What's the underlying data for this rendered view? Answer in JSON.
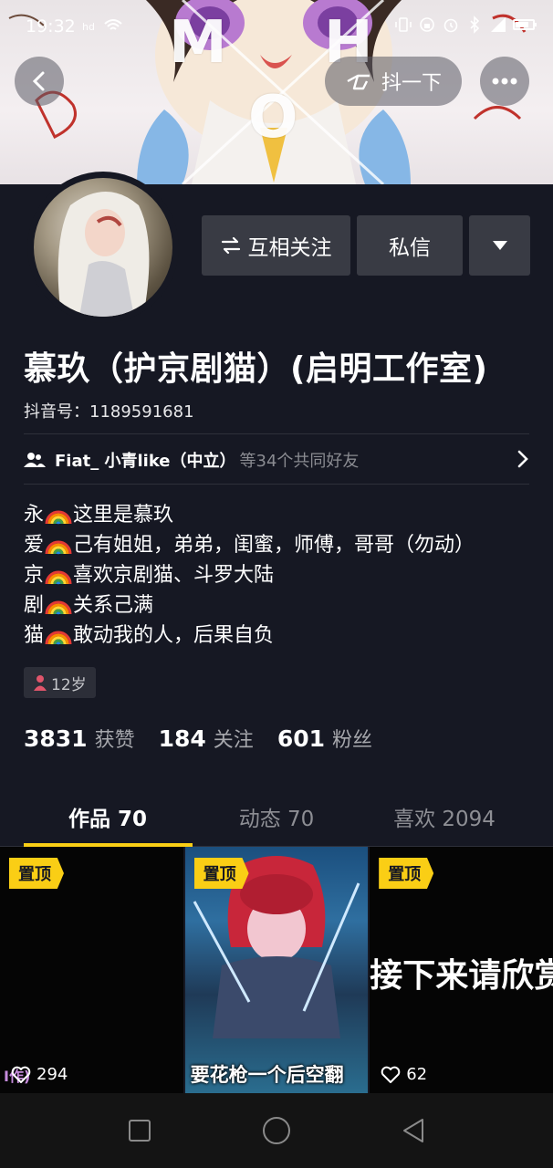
{
  "status_bar": {
    "time": "19:32",
    "extra": "hd"
  },
  "banner": {
    "watermark_m": "M",
    "watermark_h": "H",
    "watermark_o": "O",
    "shake_label": "抖一下"
  },
  "profile": {
    "name": "慕玖（护京剧猫）(启明工作室)",
    "douyin_id": "抖音号：1189591681",
    "mutual_label": "互相关注",
    "message_label": "私信"
  },
  "friends": {
    "names": "Fiat_ 小青like（中立）",
    "count": "等34个共同好友"
  },
  "bio": [
    {
      "prefix": "永",
      "text": "这里是慕玖"
    },
    {
      "prefix": "爱",
      "text": "己有姐姐，弟弟，闺蜜，师傅，哥哥（勿动）"
    },
    {
      "prefix": "京",
      "text": "喜欢京剧猫、斗罗大陆"
    },
    {
      "prefix": "剧",
      "text": "关系己满"
    },
    {
      "prefix": "猫",
      "text": "敢动我的人，后果自负"
    }
  ],
  "age_tag": "12岁",
  "stats": {
    "likes_num": "3831",
    "likes_label": "获赞",
    "following_num": "184",
    "following_label": "关注",
    "fans_num": "601",
    "fans_label": "粉丝"
  },
  "tabs": [
    "作品 70",
    "动态 70",
    "喜欢 2094"
  ],
  "videos": [
    {
      "pin": "置顶",
      "likes": "294",
      "corner_text": "I作)"
    },
    {
      "pin": "置顶",
      "caption": "要花枪一个后空翻"
    },
    {
      "pin": "置顶",
      "likes": "62",
      "overlay_text": "接下来请欣赏"
    }
  ],
  "colors": {
    "background": "#161823",
    "accent_yellow": "#face15",
    "button_gray": "#393b44"
  }
}
